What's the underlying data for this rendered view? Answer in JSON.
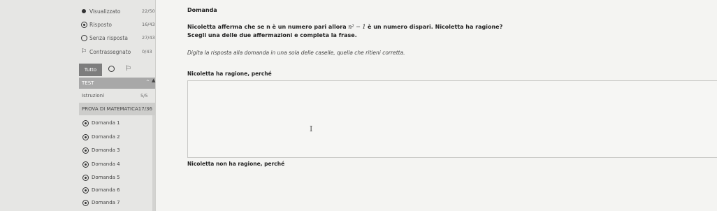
{
  "legend": [
    {
      "icon": "filled-dot",
      "label": "Visualizzato",
      "count": "22/50"
    },
    {
      "icon": "target-dot",
      "label": "Risposto",
      "count": "16/43"
    },
    {
      "icon": "empty-dot",
      "label": "Senza risposta",
      "count": "27/43"
    },
    {
      "icon": "flag",
      "label": "Contrassegnato",
      "count": "0/43"
    }
  ],
  "filters": {
    "all_label": "Tutto"
  },
  "nav": {
    "test_label": "TEST",
    "instructions_label": "Istruzioni",
    "instructions_count": "5/5",
    "section_label": "PROVA DI MATEMATICA17/36",
    "questions": [
      "Domanda 1",
      "Domanda 2",
      "Domanda 3",
      "Domanda 4",
      "Domanda 5",
      "Domanda 6",
      "Domanda 7"
    ]
  },
  "question": {
    "title": "Domanda",
    "text_a": "Nicoletta afferma che se n è un numero pari allora",
    "math": "n² − 1",
    "text_b": "è un numero dispari. Nicoletta ha ragione?",
    "subtitle": "Scegli una delle due affermazioni e completa la frase.",
    "instruction": "Digita la risposta alla domanda in una sola delle caselle, quella che ritieni corretta.",
    "answer1_label": "Nicoletta ha ragione, perché",
    "answer1_value": "",
    "answer2_label": "Nicoletta non ha ragione, perché"
  }
}
